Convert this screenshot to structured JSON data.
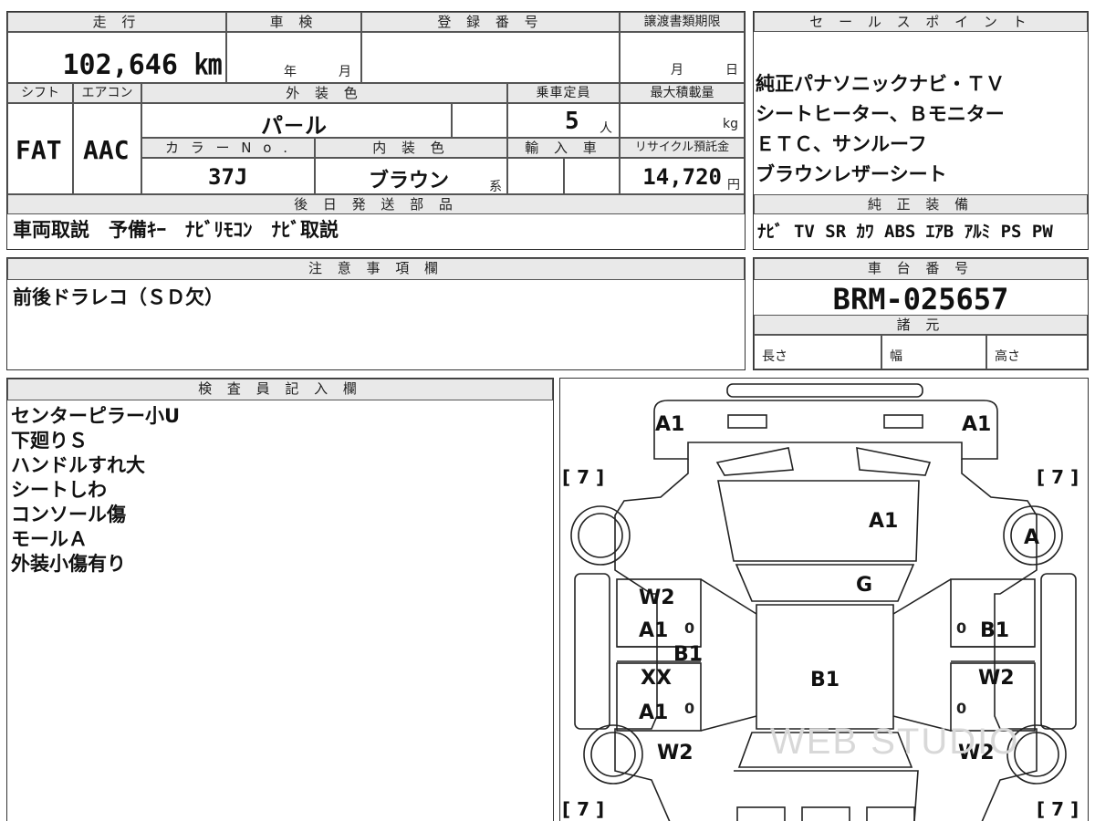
{
  "top": {
    "mileage_label": "走 行",
    "mileage_value": "102,646 ㎞",
    "inspection_label": "車 検",
    "inspection_year": "年",
    "inspection_month": "月",
    "registration_label": "登 録 番 号",
    "transfer_label": "譲渡書類期限",
    "transfer_month": "月",
    "transfer_day": "日",
    "shift_label": "シフト",
    "shift_value": "FAT",
    "ac_label": "エアコン",
    "ac_value": "AAC",
    "exterior_label": "外 装 色",
    "exterior_value": "パ－ル",
    "capacity_label": "乗車定員",
    "capacity_value": "5",
    "capacity_unit": "人",
    "load_label": "最大積載量",
    "load_unit": "kg",
    "color_no_label": "カ ラ ー N o .",
    "color_no_value": "37J",
    "interior_label": "内 装 色",
    "interior_value": "ブラウン",
    "interior_suffix": "系",
    "import_label": "輸 入 車",
    "recycle_label": "リサイクル預託金",
    "recycle_value": "14,720",
    "recycle_unit": "円",
    "later_label": "後 日 発 送 部 品",
    "later_value": "車両取説　予備ｷｰ　ﾅﾋﾞﾘﾓｺﾝ　ﾅﾋﾞ取説"
  },
  "sales": {
    "label": "セ ー ル ス ポ イ ン ト",
    "lines": [
      "純正パナソニックナビ・ＴＶ",
      "シートヒーター、Ｂモニター",
      "ＥＴＣ、サンルーフ",
      "ブラウンレザーシート"
    ],
    "equipment_label": "純 正 装 備",
    "equipment_value": "ﾅﾋﾞ TV SR ｶﾜ ABS ｴｱB ｱﾙﾐ PS PW"
  },
  "notes": {
    "label": "注 意 事 項 欄",
    "value": "前後ドラレコ（ＳＤ欠）"
  },
  "chassis": {
    "label": "車 台 番 号",
    "value": "BRM-025657",
    "spec_label": "諸 元",
    "length": "長さ",
    "width": "幅",
    "height": "高さ"
  },
  "inspector": {
    "label": "検 査 員 記 入 欄",
    "lines": [
      "センターピラー小U",
      "下廻りＳ",
      "ハンドルすれ大",
      "シートしわ",
      "コンソール傷",
      "モールＡ",
      "外装小傷有り"
    ]
  },
  "diagram": {
    "marks": {
      "a1_left": "A1",
      "a1_right": "A1",
      "a1_hood": "A1",
      "g_glass": "G",
      "a_wheel": "A",
      "w2_fl": "W2",
      "a1_fl": "A1",
      "b1_pillar": "B1",
      "xx_rl": "XX",
      "a1_rl": "A1",
      "b1_center": "B1",
      "b1_fr": "B1",
      "w2_rr": "W2",
      "w2_lw": "W2",
      "w2_rw": "W2",
      "z1": "0",
      "z2": "0",
      "z3": "0",
      "z4": "0"
    },
    "bracket_tl": "[ 7 ]",
    "bracket_tr": "[ 7 ]",
    "bracket_bl": "[ 7 ]",
    "bracket_br": "[ 7 ]",
    "watermark": "WEB STUDIO"
  }
}
